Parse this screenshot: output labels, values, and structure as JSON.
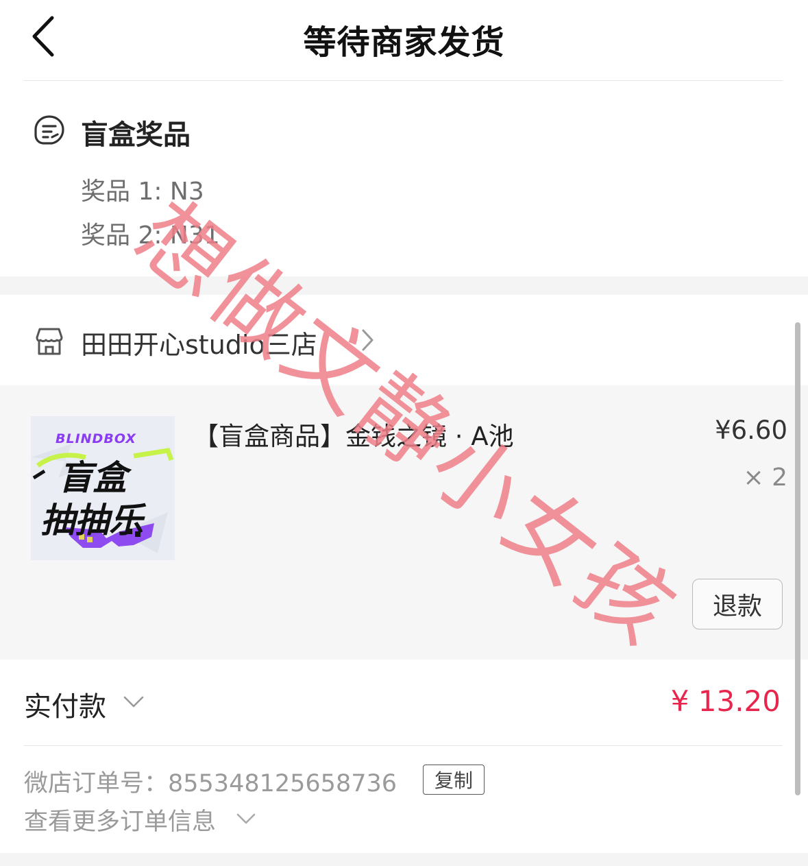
{
  "header": {
    "title": "等待商家发货"
  },
  "prizes": {
    "title": "盲盒奖品",
    "items": [
      "奖品 1: N3",
      "奖品 2: N31"
    ]
  },
  "shop": {
    "name": "田田开心studio三店"
  },
  "product": {
    "name": "【盲盒商品】金钱之镜 · A池",
    "price": "¥6.60",
    "quantity": "× 2",
    "refund_label": "退款",
    "thumb_brand": "BLINDBOX",
    "thumb_line1": "盲盒",
    "thumb_line2": "抽抽乐"
  },
  "payment": {
    "label": "实付款",
    "amount": "¥ 13.20"
  },
  "order": {
    "number_label": "微店订单号：855348125658736",
    "copy_label": "复制",
    "more_label": "查看更多订单信息"
  },
  "watermark": {
    "text": "想做文静小女孩"
  },
  "colors": {
    "accent": "#e8254c",
    "watermark": "#ee7f88"
  }
}
